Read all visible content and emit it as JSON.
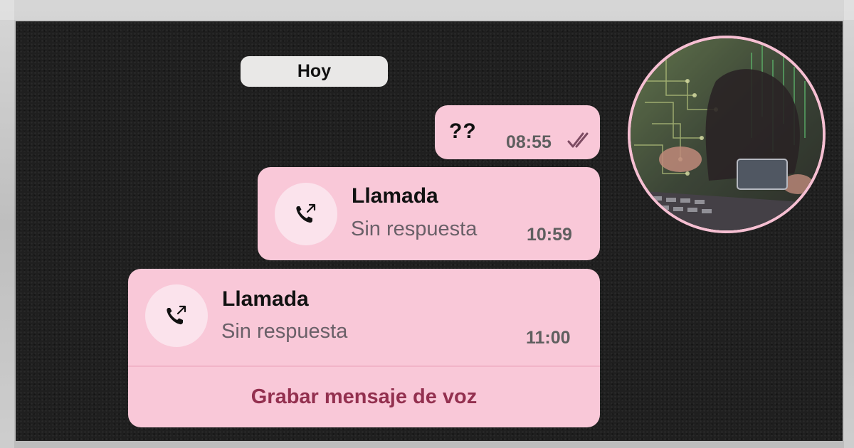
{
  "day_separator": "Hoy",
  "messages": [
    {
      "text": "??",
      "time": "08:55",
      "status_icon": "double-check-icon"
    },
    {
      "title": "Llamada",
      "subtitle": "Sin respuesta",
      "time": "10:59",
      "icon": "outgoing-call-icon"
    },
    {
      "title": "Llamada",
      "subtitle": "Sin respuesta",
      "time": "11:00",
      "icon": "outgoing-call-icon",
      "action_label": "Grabar mensaje de voz"
    }
  ],
  "colors": {
    "bubble": "#f9c8d8",
    "accent_text": "#93304f",
    "panel": "#1f1f1f",
    "pill": "#e9e8e7",
    "tick": "#7d4b62"
  }
}
